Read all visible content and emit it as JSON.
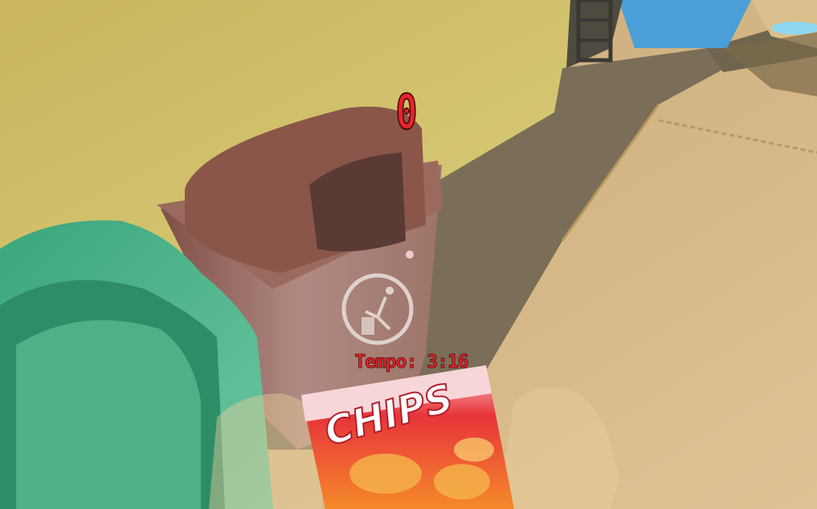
{
  "hud": {
    "score": "0",
    "timer": "Tempo: 3:16"
  },
  "held_item": {
    "brand": "CHIPS"
  },
  "colors": {
    "hud_text": "#e8242c",
    "wall": "#cfc06a",
    "floor": "#d8b884",
    "path": "#7a6e58",
    "trash_bin": "#8a5a4e",
    "green_bin": "#2f9a70",
    "chips_bag": "#e83a3a"
  },
  "icons": [
    "recycle-person-icon",
    "crosshair-icon"
  ]
}
